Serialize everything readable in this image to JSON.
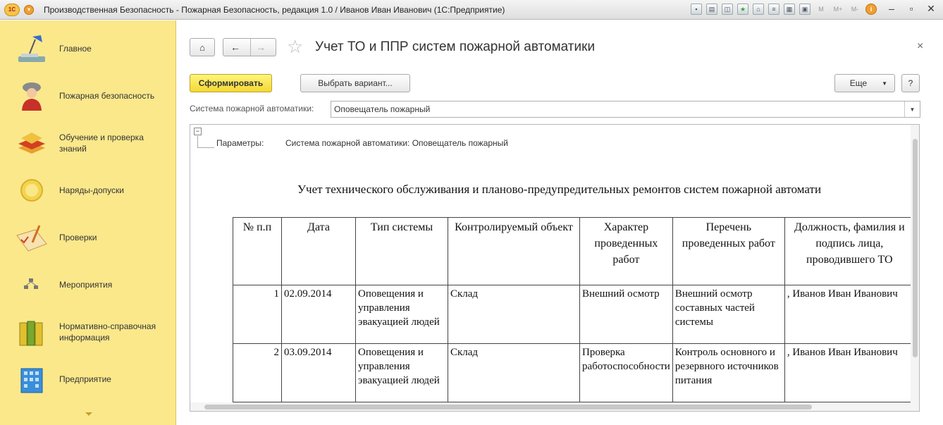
{
  "window": {
    "title": "Производственная Безопасность - Пожарная Безопасность, редакция 1.0 / Иванов Иван Иванович (1С:Предприятие)",
    "logo_text": "1С",
    "toolbar_icons": [
      "save-icon",
      "print-icon",
      "preview-icon",
      "favorites-icon",
      "history-icon",
      "list-icon",
      "calendar-icon",
      "calculator-icon"
    ],
    "memory_buttons": [
      "M",
      "M+",
      "M-"
    ],
    "info_icon": "i"
  },
  "sidebar": {
    "items": [
      {
        "label": "Главное",
        "icon": "desk-lamp-icon"
      },
      {
        "label": "Пожарная безопасность",
        "icon": "firefighter-icon"
      },
      {
        "label": "Обучение и проверка знаний",
        "icon": "books-icon"
      },
      {
        "label": "Наряды-допуски",
        "icon": "coin-icon"
      },
      {
        "label": "Проверки",
        "icon": "checklist-icon"
      },
      {
        "label": "Мероприятия",
        "icon": "org-chart-icon"
      },
      {
        "label": "Нормативно-справочная информация",
        "icon": "binders-icon"
      },
      {
        "label": "Предприятие",
        "icon": "building-icon"
      }
    ]
  },
  "main": {
    "title": "Учет ТО и ППР систем пожарной автоматики",
    "generate_button": "Сформировать",
    "variant_button": "Выбрать вариант...",
    "more_button": "Еще",
    "help_button": "?",
    "close_symbol": "×",
    "filter": {
      "label": "Система пожарной автоматики:",
      "value": "Оповещатель пожарный"
    }
  },
  "report": {
    "collapse_symbol": "−",
    "params_label": "Параметры:",
    "params_value": "Система пожарной автоматики: Оповещатель пожарный",
    "title": "Учет технического обслуживания и планово-предупредительных ремонтов систем пожарной автомати",
    "columns": [
      "№ п.п",
      "Дата",
      "Тип системы",
      "Контролируемый объект",
      "Характер проведенных работ",
      "Перечень проведенных работ",
      "Должность, фамилия и подпись лица, проводившего ТО"
    ],
    "rows": [
      [
        "1",
        "02.09.2014",
        "Оповещения и управления эвакуацией людей",
        "Склад",
        "Внешний осмотр",
        "Внешний осмотр составных частей системы",
        ", Иванов Иван Иванович"
      ],
      [
        "2",
        "03.09.2014",
        "Оповещения и управления эвакуацией людей",
        "Склад",
        "Проверка работоспособности",
        "Контроль основного и резервного источников питания",
        ", Иванов Иван Иванович"
      ]
    ]
  }
}
